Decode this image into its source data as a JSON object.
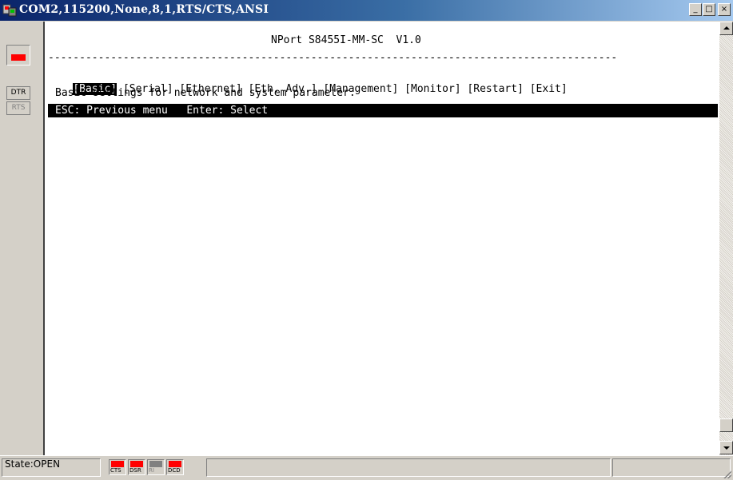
{
  "window": {
    "title": "COM2,115200,None,8,1,RTS/CTS,ANSI",
    "minimize_glyph": "_",
    "maximize_glyph": "□",
    "close_glyph": "×"
  },
  "signals_left": {
    "led_color": "#ff0000",
    "dtr_label": "DTR",
    "rts_label": "RTS"
  },
  "terminal": {
    "header": "NPort S8455I-MM-SC  V1.0",
    "separator": "-------------------------------------------------------------------------------------------",
    "menu": [
      {
        "label": "[Basic]",
        "active": true
      },
      {
        "label": "[Serial]",
        "active": false
      },
      {
        "label": "[Ethernet]",
        "active": false
      },
      {
        "label": "[Eth. Adv.]",
        "active": false
      },
      {
        "label": "[Management]",
        "active": false
      },
      {
        "label": "[Monitor]",
        "active": false
      },
      {
        "label": "[Restart]",
        "active": false
      },
      {
        "label": "[Exit]",
        "active": false
      }
    ],
    "description": "Basic settings for network and system parameter.",
    "hint": "ESC: Previous menu   Enter: Select"
  },
  "statusbar": {
    "state": "State:OPEN",
    "leds": [
      {
        "label": "CTS",
        "on": true,
        "color": "#ff0000"
      },
      {
        "label": "DSR",
        "on": true,
        "color": "#ff0000"
      },
      {
        "label": "RI",
        "on": false,
        "color": "#808080"
      },
      {
        "label": "DCD",
        "on": true,
        "color": "#ff0000"
      }
    ]
  },
  "colors": {
    "titlebar_start": "#0a246a",
    "titlebar_end": "#a6caf0",
    "chrome": "#d4d0c8",
    "terminal_bg": "#ffffff",
    "highlight_bg": "#000000"
  }
}
